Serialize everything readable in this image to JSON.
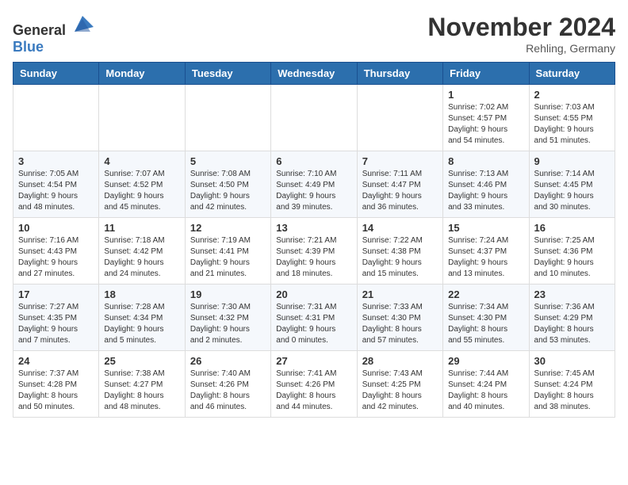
{
  "header": {
    "logo_general": "General",
    "logo_blue": "Blue",
    "month_title": "November 2024",
    "location": "Rehling, Germany"
  },
  "days_of_week": [
    "Sunday",
    "Monday",
    "Tuesday",
    "Wednesday",
    "Thursday",
    "Friday",
    "Saturday"
  ],
  "weeks": [
    [
      {
        "day": "",
        "info": ""
      },
      {
        "day": "",
        "info": ""
      },
      {
        "day": "",
        "info": ""
      },
      {
        "day": "",
        "info": ""
      },
      {
        "day": "",
        "info": ""
      },
      {
        "day": "1",
        "info": "Sunrise: 7:02 AM\nSunset: 4:57 PM\nDaylight: 9 hours\nand 54 minutes."
      },
      {
        "day": "2",
        "info": "Sunrise: 7:03 AM\nSunset: 4:55 PM\nDaylight: 9 hours\nand 51 minutes."
      }
    ],
    [
      {
        "day": "3",
        "info": "Sunrise: 7:05 AM\nSunset: 4:54 PM\nDaylight: 9 hours\nand 48 minutes."
      },
      {
        "day": "4",
        "info": "Sunrise: 7:07 AM\nSunset: 4:52 PM\nDaylight: 9 hours\nand 45 minutes."
      },
      {
        "day": "5",
        "info": "Sunrise: 7:08 AM\nSunset: 4:50 PM\nDaylight: 9 hours\nand 42 minutes."
      },
      {
        "day": "6",
        "info": "Sunrise: 7:10 AM\nSunset: 4:49 PM\nDaylight: 9 hours\nand 39 minutes."
      },
      {
        "day": "7",
        "info": "Sunrise: 7:11 AM\nSunset: 4:47 PM\nDaylight: 9 hours\nand 36 minutes."
      },
      {
        "day": "8",
        "info": "Sunrise: 7:13 AM\nSunset: 4:46 PM\nDaylight: 9 hours\nand 33 minutes."
      },
      {
        "day": "9",
        "info": "Sunrise: 7:14 AM\nSunset: 4:45 PM\nDaylight: 9 hours\nand 30 minutes."
      }
    ],
    [
      {
        "day": "10",
        "info": "Sunrise: 7:16 AM\nSunset: 4:43 PM\nDaylight: 9 hours\nand 27 minutes."
      },
      {
        "day": "11",
        "info": "Sunrise: 7:18 AM\nSunset: 4:42 PM\nDaylight: 9 hours\nand 24 minutes."
      },
      {
        "day": "12",
        "info": "Sunrise: 7:19 AM\nSunset: 4:41 PM\nDaylight: 9 hours\nand 21 minutes."
      },
      {
        "day": "13",
        "info": "Sunrise: 7:21 AM\nSunset: 4:39 PM\nDaylight: 9 hours\nand 18 minutes."
      },
      {
        "day": "14",
        "info": "Sunrise: 7:22 AM\nSunset: 4:38 PM\nDaylight: 9 hours\nand 15 minutes."
      },
      {
        "day": "15",
        "info": "Sunrise: 7:24 AM\nSunset: 4:37 PM\nDaylight: 9 hours\nand 13 minutes."
      },
      {
        "day": "16",
        "info": "Sunrise: 7:25 AM\nSunset: 4:36 PM\nDaylight: 9 hours\nand 10 minutes."
      }
    ],
    [
      {
        "day": "17",
        "info": "Sunrise: 7:27 AM\nSunset: 4:35 PM\nDaylight: 9 hours\nand 7 minutes."
      },
      {
        "day": "18",
        "info": "Sunrise: 7:28 AM\nSunset: 4:34 PM\nDaylight: 9 hours\nand 5 minutes."
      },
      {
        "day": "19",
        "info": "Sunrise: 7:30 AM\nSunset: 4:32 PM\nDaylight: 9 hours\nand 2 minutes."
      },
      {
        "day": "20",
        "info": "Sunrise: 7:31 AM\nSunset: 4:31 PM\nDaylight: 9 hours\nand 0 minutes."
      },
      {
        "day": "21",
        "info": "Sunrise: 7:33 AM\nSunset: 4:30 PM\nDaylight: 8 hours\nand 57 minutes."
      },
      {
        "day": "22",
        "info": "Sunrise: 7:34 AM\nSunset: 4:30 PM\nDaylight: 8 hours\nand 55 minutes."
      },
      {
        "day": "23",
        "info": "Sunrise: 7:36 AM\nSunset: 4:29 PM\nDaylight: 8 hours\nand 53 minutes."
      }
    ],
    [
      {
        "day": "24",
        "info": "Sunrise: 7:37 AM\nSunset: 4:28 PM\nDaylight: 8 hours\nand 50 minutes."
      },
      {
        "day": "25",
        "info": "Sunrise: 7:38 AM\nSunset: 4:27 PM\nDaylight: 8 hours\nand 48 minutes."
      },
      {
        "day": "26",
        "info": "Sunrise: 7:40 AM\nSunset: 4:26 PM\nDaylight: 8 hours\nand 46 minutes."
      },
      {
        "day": "27",
        "info": "Sunrise: 7:41 AM\nSunset: 4:26 PM\nDaylight: 8 hours\nand 44 minutes."
      },
      {
        "day": "28",
        "info": "Sunrise: 7:43 AM\nSunset: 4:25 PM\nDaylight: 8 hours\nand 42 minutes."
      },
      {
        "day": "29",
        "info": "Sunrise: 7:44 AM\nSunset: 4:24 PM\nDaylight: 8 hours\nand 40 minutes."
      },
      {
        "day": "30",
        "info": "Sunrise: 7:45 AM\nSunset: 4:24 PM\nDaylight: 8 hours\nand 38 minutes."
      }
    ]
  ]
}
